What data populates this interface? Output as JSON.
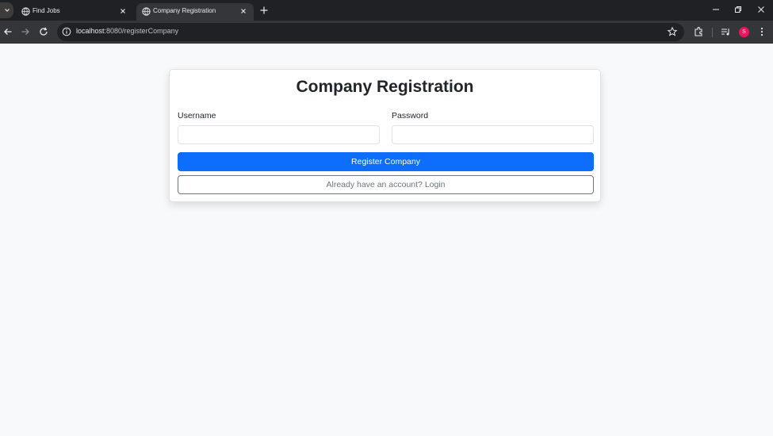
{
  "browser": {
    "tabs": [
      {
        "title": "Find Jobs",
        "active": false
      },
      {
        "title": "Company Registration",
        "active": true
      }
    ],
    "address": {
      "host": "localhost",
      "rest": ":8080/registerCompany"
    },
    "profile_initial": "S",
    "profile_color": "#e8175d"
  },
  "form": {
    "title": "Company Registration",
    "username_label": "Username",
    "username_value": "",
    "password_label": "Password",
    "password_value": "",
    "register_label": "Register Company",
    "login_label": "Already have an account? Login"
  },
  "colors": {
    "primary": "#0d6efd",
    "secondary": "#6c757d",
    "page_bg": "#f8f9fa"
  }
}
